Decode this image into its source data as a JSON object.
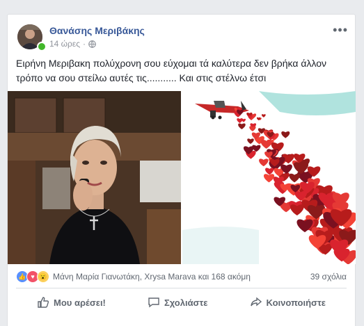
{
  "post": {
    "author": "Θανάσης Μεριβάκης",
    "time": "14 ώρες",
    "text": "Ειρήνη Μεριβακη πολύχρονη σου εύχομαι τά καλύτερα δεν βρήκα άλλον τρόπο να σου στείλω αυτές τις........... Και στις στέλνω έτσι",
    "privacy_icon": "globe-icon",
    "menu_icon": "more-icon"
  },
  "reactions": {
    "types": [
      "like",
      "love",
      "wow"
    ],
    "reactors_text": "Μάνη Μαρία Γιανωτάκη, Xrysa Marava και 168 ακόμη",
    "comments_text": "39 σχόλια"
  },
  "actions": {
    "like": "Μου αρέσει!",
    "comment": "Σχολιάστε",
    "share": "Κοινοποιήστε"
  },
  "colors": {
    "link": "#385898",
    "online": "#42b72a",
    "heart": "#d9232e"
  }
}
